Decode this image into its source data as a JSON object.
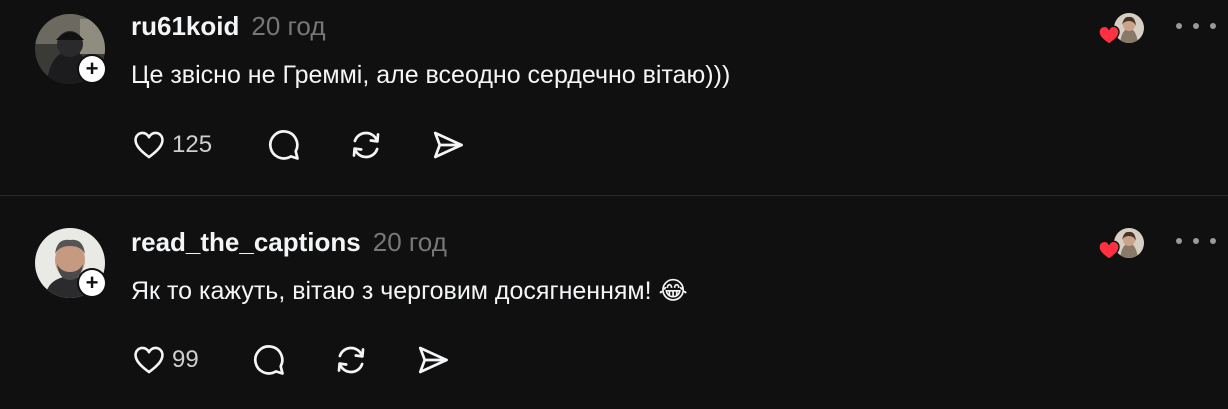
{
  "posts": [
    {
      "username": "ru61koid",
      "time": "20 год",
      "text": "Це звісно не Греммі, але всеодно сердечно вітаю)))",
      "likes": "125"
    },
    {
      "username": "read_the_captions",
      "time": "20 год",
      "text": "Як то кажуть, вітаю з черговим досягненням! 😂",
      "likes": "99"
    }
  ],
  "icons": {
    "like": "heart-icon",
    "comment": "comment-icon",
    "repost": "repost-icon",
    "share": "send-icon",
    "follow": "plus-icon",
    "more": "more-icon",
    "liked_by_author": "heart-icon"
  },
  "colors": {
    "background": "#101010",
    "text": "#f3f5f7",
    "muted": "#777777",
    "heart_red": "#ff3040",
    "divider": "#2a2a2a"
  }
}
